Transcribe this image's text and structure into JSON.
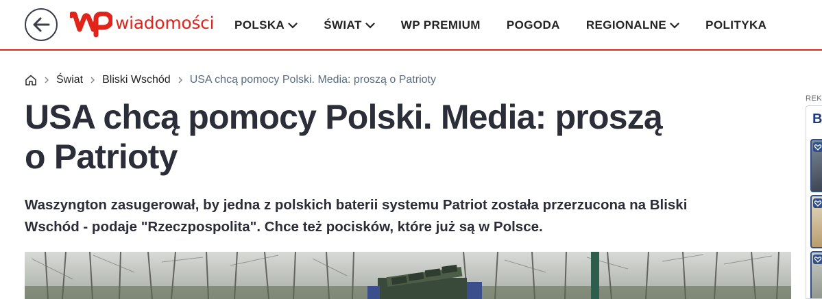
{
  "header": {
    "logo_text": "wiadomości",
    "nav": [
      {
        "label": "POLSKA",
        "has_dropdown": true
      },
      {
        "label": "ŚWIAT",
        "has_dropdown": true
      },
      {
        "label": "WP PREMIUM",
        "has_dropdown": false
      },
      {
        "label": "POGODA",
        "has_dropdown": false
      },
      {
        "label": "REGIONALNE",
        "has_dropdown": true
      },
      {
        "label": "POLITYKA",
        "has_dropdown": false
      }
    ],
    "back_icon": "arrow-left-icon"
  },
  "breadcrumb": {
    "home_icon": "home-icon",
    "items": [
      "Świat",
      "Bliski Wschód"
    ],
    "current": "USA chcą pomocy Polski. Media: proszą o Patrioty"
  },
  "article": {
    "title_line1": "USA chcą pomocy Polski. Media: proszą",
    "title_line2": "o Patrioty",
    "lead_line1": "Waszyngton zasugerował, by jedna z polskich baterii systemu Patriot została przerzucona na Bliski",
    "lead_line2": "Wschód - podaje \"Rzeczpospolita\". Chce też pocisków, które już są w Polsce."
  },
  "sidebar_ad": {
    "label": "REK",
    "heading": "B"
  },
  "colors": {
    "brand_red": "#e2231a",
    "text_dark": "#2b2e38",
    "breadcrumb_current": "#5a6b80",
    "ad_blue": "#2e4f8a"
  }
}
